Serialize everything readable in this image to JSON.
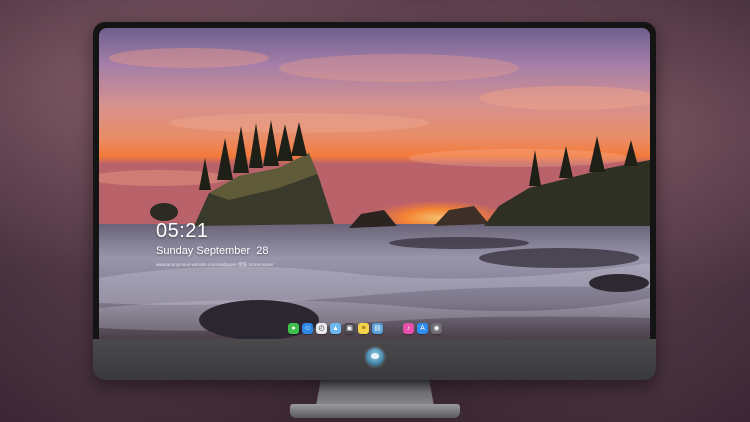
{
  "lock_screen": {
    "time": "05:21",
    "date": "Sunday September  28",
    "subtitle": "www.anonymous-website.com/wallpaper  壁纸  Screensaver"
  },
  "dock": {
    "apps": [
      {
        "name": "messages",
        "color": "#3fbf4d",
        "glyph": "●"
      },
      {
        "name": "finder",
        "color": "#2f88e6",
        "glyph": "☺"
      },
      {
        "name": "clock",
        "color": "#e9e9ec",
        "glyph": "◴"
      },
      {
        "name": "maps",
        "color": "#6bb7f0",
        "glyph": "▲"
      },
      {
        "name": "clapper",
        "color": "#4a4a4e",
        "glyph": "▣"
      },
      {
        "name": "notes",
        "color": "#f5d34a",
        "glyph": "≡"
      },
      {
        "name": "preview",
        "color": "#5aa0d8",
        "glyph": "▤"
      },
      {
        "name": "itunes",
        "color": "#e84fa8",
        "glyph": "♪"
      },
      {
        "name": "app-store",
        "color": "#2f8df0",
        "glyph": "A"
      },
      {
        "name": "screenshot",
        "color": "#6e6e74",
        "glyph": "◉"
      }
    ]
  },
  "colors": {
    "monitor_bezel": "#141414",
    "monitor_chin": "#3f3f41",
    "sunset_orange": "#f0763a"
  }
}
